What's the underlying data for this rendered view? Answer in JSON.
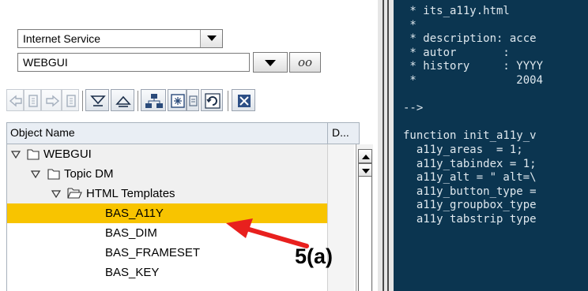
{
  "navigator": {
    "object_type_select": {
      "value": "Internet Service"
    },
    "object_name_select": {
      "value": "WEBGUI"
    },
    "display_button_icon": "glasses-icon"
  },
  "toolbar": {
    "buttons": [
      "back-icon",
      "back-list-icon",
      "forward-icon",
      "forward-list-icon",
      "expand-all-icon",
      "collapse-all-icon",
      "hierarchy-icon",
      "new-object-icon",
      "refresh-icon",
      "close-icon"
    ]
  },
  "tree": {
    "columns": {
      "name": "Object Name",
      "d": "D..."
    },
    "rows": [
      {
        "label": "WEBGUI",
        "level": 0,
        "node": "folder"
      },
      {
        "label": "Topic DM",
        "level": 1,
        "node": "folder"
      },
      {
        "label": "HTML Templates",
        "level": 2,
        "node": "folder-open"
      },
      {
        "label": "BAS_A11Y",
        "level": 3,
        "node": "leaf",
        "selected": true
      },
      {
        "label": "BAS_DIM",
        "level": 3,
        "node": "leaf"
      },
      {
        "label": "BAS_FRAMESET",
        "level": 3,
        "node": "leaf"
      },
      {
        "label": "BAS_KEY",
        "level": 3,
        "node": "leaf"
      }
    ]
  },
  "editor": {
    "lines": [
      " * its_a11y.html",
      " *",
      " * description: acce",
      " * autor       :",
      " * history     : YYYY",
      " *               2004",
      "",
      "-->",
      "",
      "function init_a11y_v",
      "  a11y_areas  = 1;",
      "  a11y_tabindex = 1;",
      "  a11y_alt = \" alt=\\",
      "  a11y_button_type =",
      "  a11y_groupbox_type",
      "  a11y tabstrip type"
    ]
  },
  "annotation": {
    "label": "5(a)",
    "color": "#e8201e"
  },
  "colors": {
    "selection": "#f8c400",
    "editor_bg": "#0b3550",
    "tree_header": "#e9eef4"
  }
}
